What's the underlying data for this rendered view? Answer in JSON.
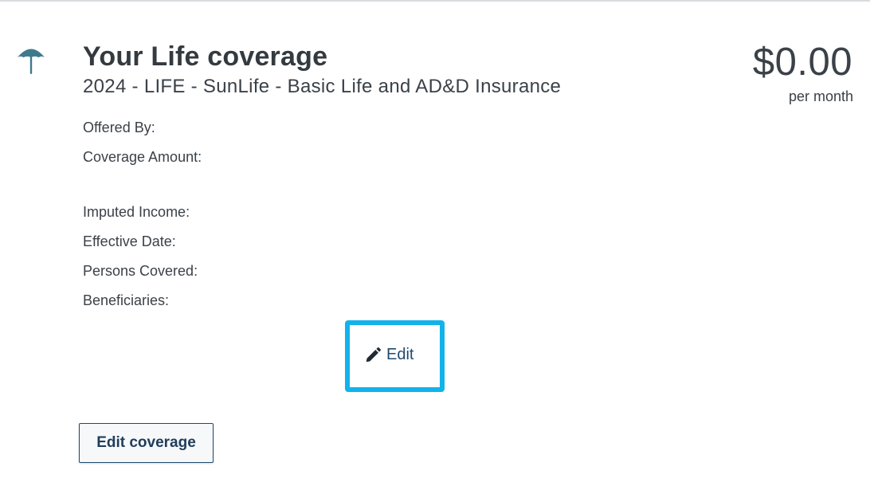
{
  "coverage": {
    "title": "Your Life coverage",
    "plan_name": "2024 - LIFE - SunLife - Basic Life and AD&D Insurance",
    "price": "$0.00",
    "price_period": "per month",
    "icon": "umbrella-icon",
    "icon_color": "#3e7a8c"
  },
  "details": {
    "offered_by_label": "Offered By:",
    "coverage_amount_label": "Coverage Amount:",
    "imputed_income_label": "Imputed Income:",
    "effective_date_label": "Effective Date:",
    "persons_covered_label": "Persons Covered:",
    "beneficiaries_label": "Beneficiaries:"
  },
  "actions": {
    "edit_label": "Edit",
    "edit_icon": "pencil-icon",
    "edit_coverage_label": "Edit coverage",
    "highlight_color": "#12b2ea"
  }
}
